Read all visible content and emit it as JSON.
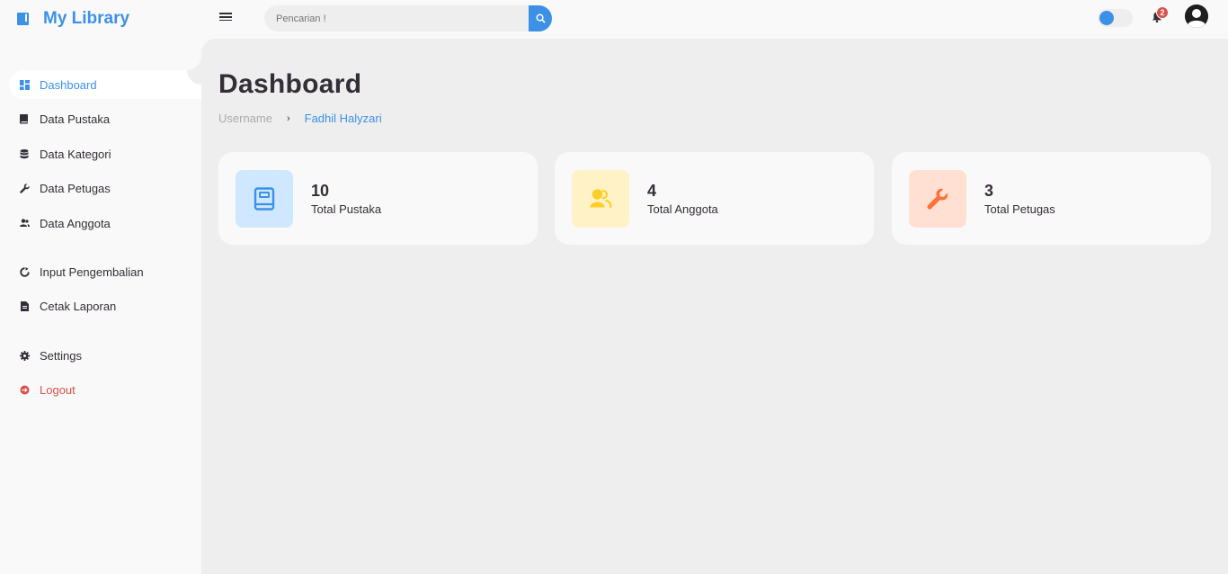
{
  "brand": {
    "title": "My Library",
    "icon": "book-icon"
  },
  "topbar": {
    "search_placeholder": "Pencarian !",
    "notification_count": "2",
    "theme_toggle_on": true
  },
  "sidebar": {
    "items": [
      {
        "label": "Dashboard",
        "icon": "dashboard-icon",
        "active": true
      },
      {
        "label": "Data Pustaka",
        "icon": "book-icon"
      },
      {
        "label": "Data Kategori",
        "icon": "database-icon"
      },
      {
        "label": "Data Petugas",
        "icon": "wrench-icon"
      },
      {
        "label": "Data Anggota",
        "icon": "users-icon"
      },
      {
        "label": "Input Pengembalian",
        "icon": "refresh-icon"
      },
      {
        "label": "Cetak Laporan",
        "icon": "document-icon"
      },
      {
        "label": "Settings",
        "icon": "gear-icon"
      },
      {
        "label": "Logout",
        "icon": "logout-icon"
      }
    ]
  },
  "main": {
    "title": "Dashboard",
    "breadcrumb": {
      "first": "Username",
      "separator": "›",
      "second": "Fadhil Halyzari"
    },
    "cards": [
      {
        "value": "10",
        "label": "Total Pustaka",
        "icon": "book-icon",
        "bg": "#cfe8ff",
        "fg": "#3c91e6"
      },
      {
        "value": "4",
        "label": "Total Anggota",
        "icon": "users-icon",
        "bg": "#fff2c6",
        "fg": "#ffce26"
      },
      {
        "value": "3",
        "label": "Total Petugas",
        "icon": "wrench-icon",
        "bg": "#ffe0d3",
        "fg": "#fd7238"
      }
    ]
  },
  "colors": {
    "accent": "#3c91e6",
    "danger": "#db504a",
    "background": "#eeeeee",
    "surface": "#f9f9f9"
  }
}
